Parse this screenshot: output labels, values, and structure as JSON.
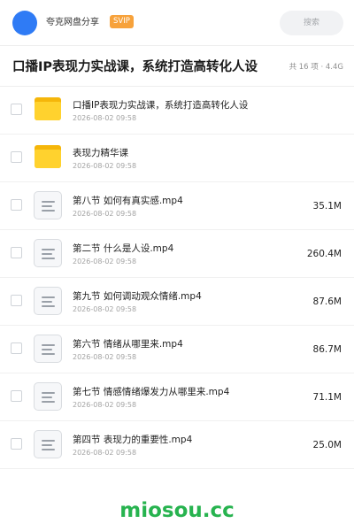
{
  "header": {
    "share_name": "夸克网盘分享",
    "badge": "SVIP",
    "search_placeholder": "搜索"
  },
  "folder": {
    "title": "口播IP表现力实战课，系统打造高转化人设",
    "meta": "共 16 项 · 4.4G"
  },
  "items": [
    {
      "type": "folder",
      "name": "口播IP表现力实战课，系统打造高转化人设",
      "date": "2026-08-02 09:58",
      "size": ""
    },
    {
      "type": "folder",
      "name": "表现力精华课",
      "date": "2026-08-02 09:58",
      "size": ""
    },
    {
      "type": "file",
      "name": "第八节 如何有真实感.mp4",
      "date": "2026-08-02 09:58",
      "size": "35.1M"
    },
    {
      "type": "file",
      "name": "第二节 什么是人设.mp4",
      "date": "2026-08-02 09:58",
      "size": "260.4M"
    },
    {
      "type": "file",
      "name": "第九节 如何调动观众情绪.mp4",
      "date": "2026-08-02 09:58",
      "size": "87.6M"
    },
    {
      "type": "file",
      "name": "第六节 情绪从哪里来.mp4",
      "date": "2026-08-02 09:58",
      "size": "86.7M"
    },
    {
      "type": "file",
      "name": "第七节 情感情绪爆发力从哪里来.mp4",
      "date": "2026-08-02 09:58",
      "size": "71.1M"
    },
    {
      "type": "file",
      "name": "第四节 表现力的重要性.mp4",
      "date": "2026-08-02 09:58",
      "size": "25.0M"
    }
  ],
  "watermark": "miosou.cc",
  "colors": {
    "avatar": "#2f7bf5",
    "svip_badge": "#f7a23b",
    "folder": "#ffd22e",
    "watermark": "#27b34f"
  }
}
